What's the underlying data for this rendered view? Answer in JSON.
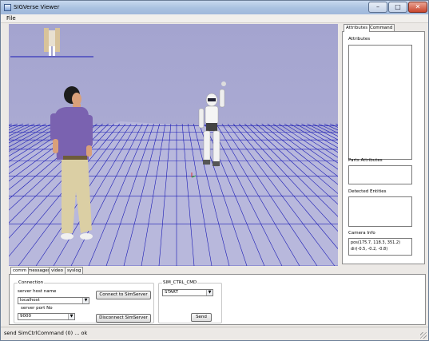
{
  "window": {
    "title": "SIGVerse Viewer"
  },
  "menu": {
    "file": "File"
  },
  "right_panel": {
    "tabs": [
      "Attributes",
      "Command"
    ],
    "attributes_label": "Attributes",
    "parts_attributes_label": "Parts Attributes",
    "detected_entities_label": "Detected Entities",
    "camera_info_label": "Camera Info",
    "camera_pos": "pos(175.7, 118.3, 351.2)",
    "camera_dir": "dir(-0.5, -0.2, -0.8)"
  },
  "bottom_tabs": [
    "comm",
    "messages",
    "video",
    "syslog"
  ],
  "connection": {
    "group_title": "Connection",
    "host_label": "server host name",
    "host_value": "localhost",
    "port_label": "server port No",
    "port_value": "9000",
    "connect_button": "Connect to SimServer",
    "disconnect_button": "Disconnect SimServer"
  },
  "sim_ctrl": {
    "group_title": "SIM_CTRL_CMD",
    "command_value": "START",
    "send_button": "Send"
  },
  "status": {
    "text": "send SimCtrlCommand (0) ... ok"
  },
  "colors": {
    "floor_grid": "#1a1ab8",
    "sky": "#a8a8d2",
    "floor": "#b8b8d8"
  }
}
